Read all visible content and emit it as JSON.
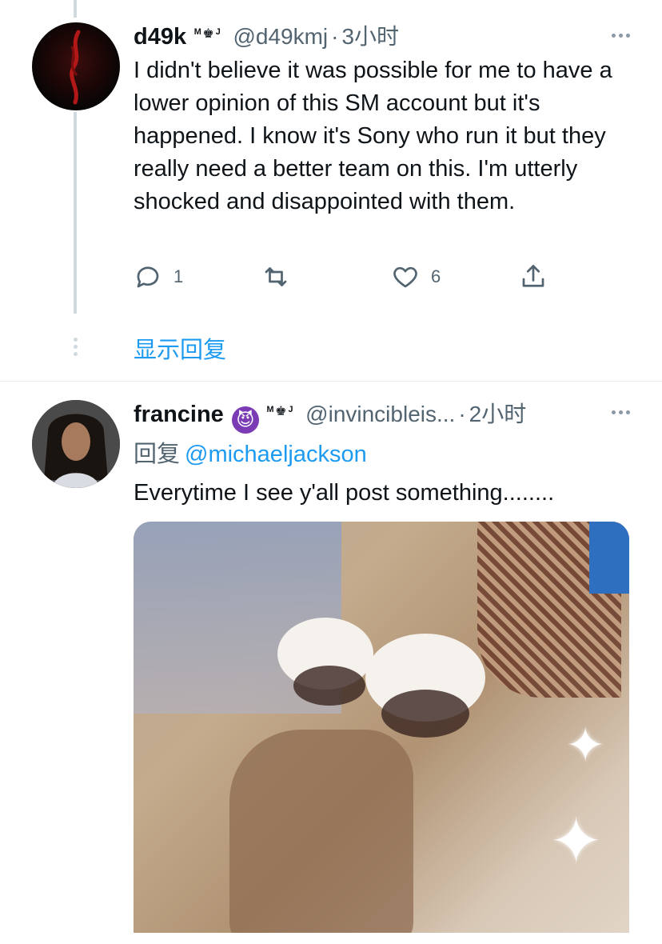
{
  "tweets": [
    {
      "display_name": "d49k",
      "badge": "ᴹ♚ᴶ",
      "handle": "@d49kmj",
      "separator": "·",
      "time": "3小时",
      "text": "I didn't believe it was possible for me to have a lower opinion of this SM account but it's happened. I know it's Sony who run it but they really need a better team on this.  I'm utterly shocked and disappointed with them.",
      "actions": {
        "reply_count": "1",
        "retweet_count": "",
        "like_count": "6"
      },
      "show_replies_label": "显示回复"
    },
    {
      "display_name": "francine",
      "emoji": "😈",
      "badge": "ᴹ♚ᴶ",
      "handle": "@invincibleis...",
      "separator": "·",
      "time": "2小时",
      "reply_prefix": "回复",
      "reply_mention": "@michaeljackson",
      "text": "Everytime I see y'all post something........"
    }
  ],
  "colors": {
    "link": "#1d9bf0",
    "secondary_text": "#536471",
    "primary_text": "#0f1419",
    "thread_line": "#cfd9de"
  },
  "icons": {
    "reply": "reply-icon",
    "retweet": "retweet-icon",
    "like": "heart-icon",
    "share": "share-icon",
    "more": "more-icon"
  }
}
